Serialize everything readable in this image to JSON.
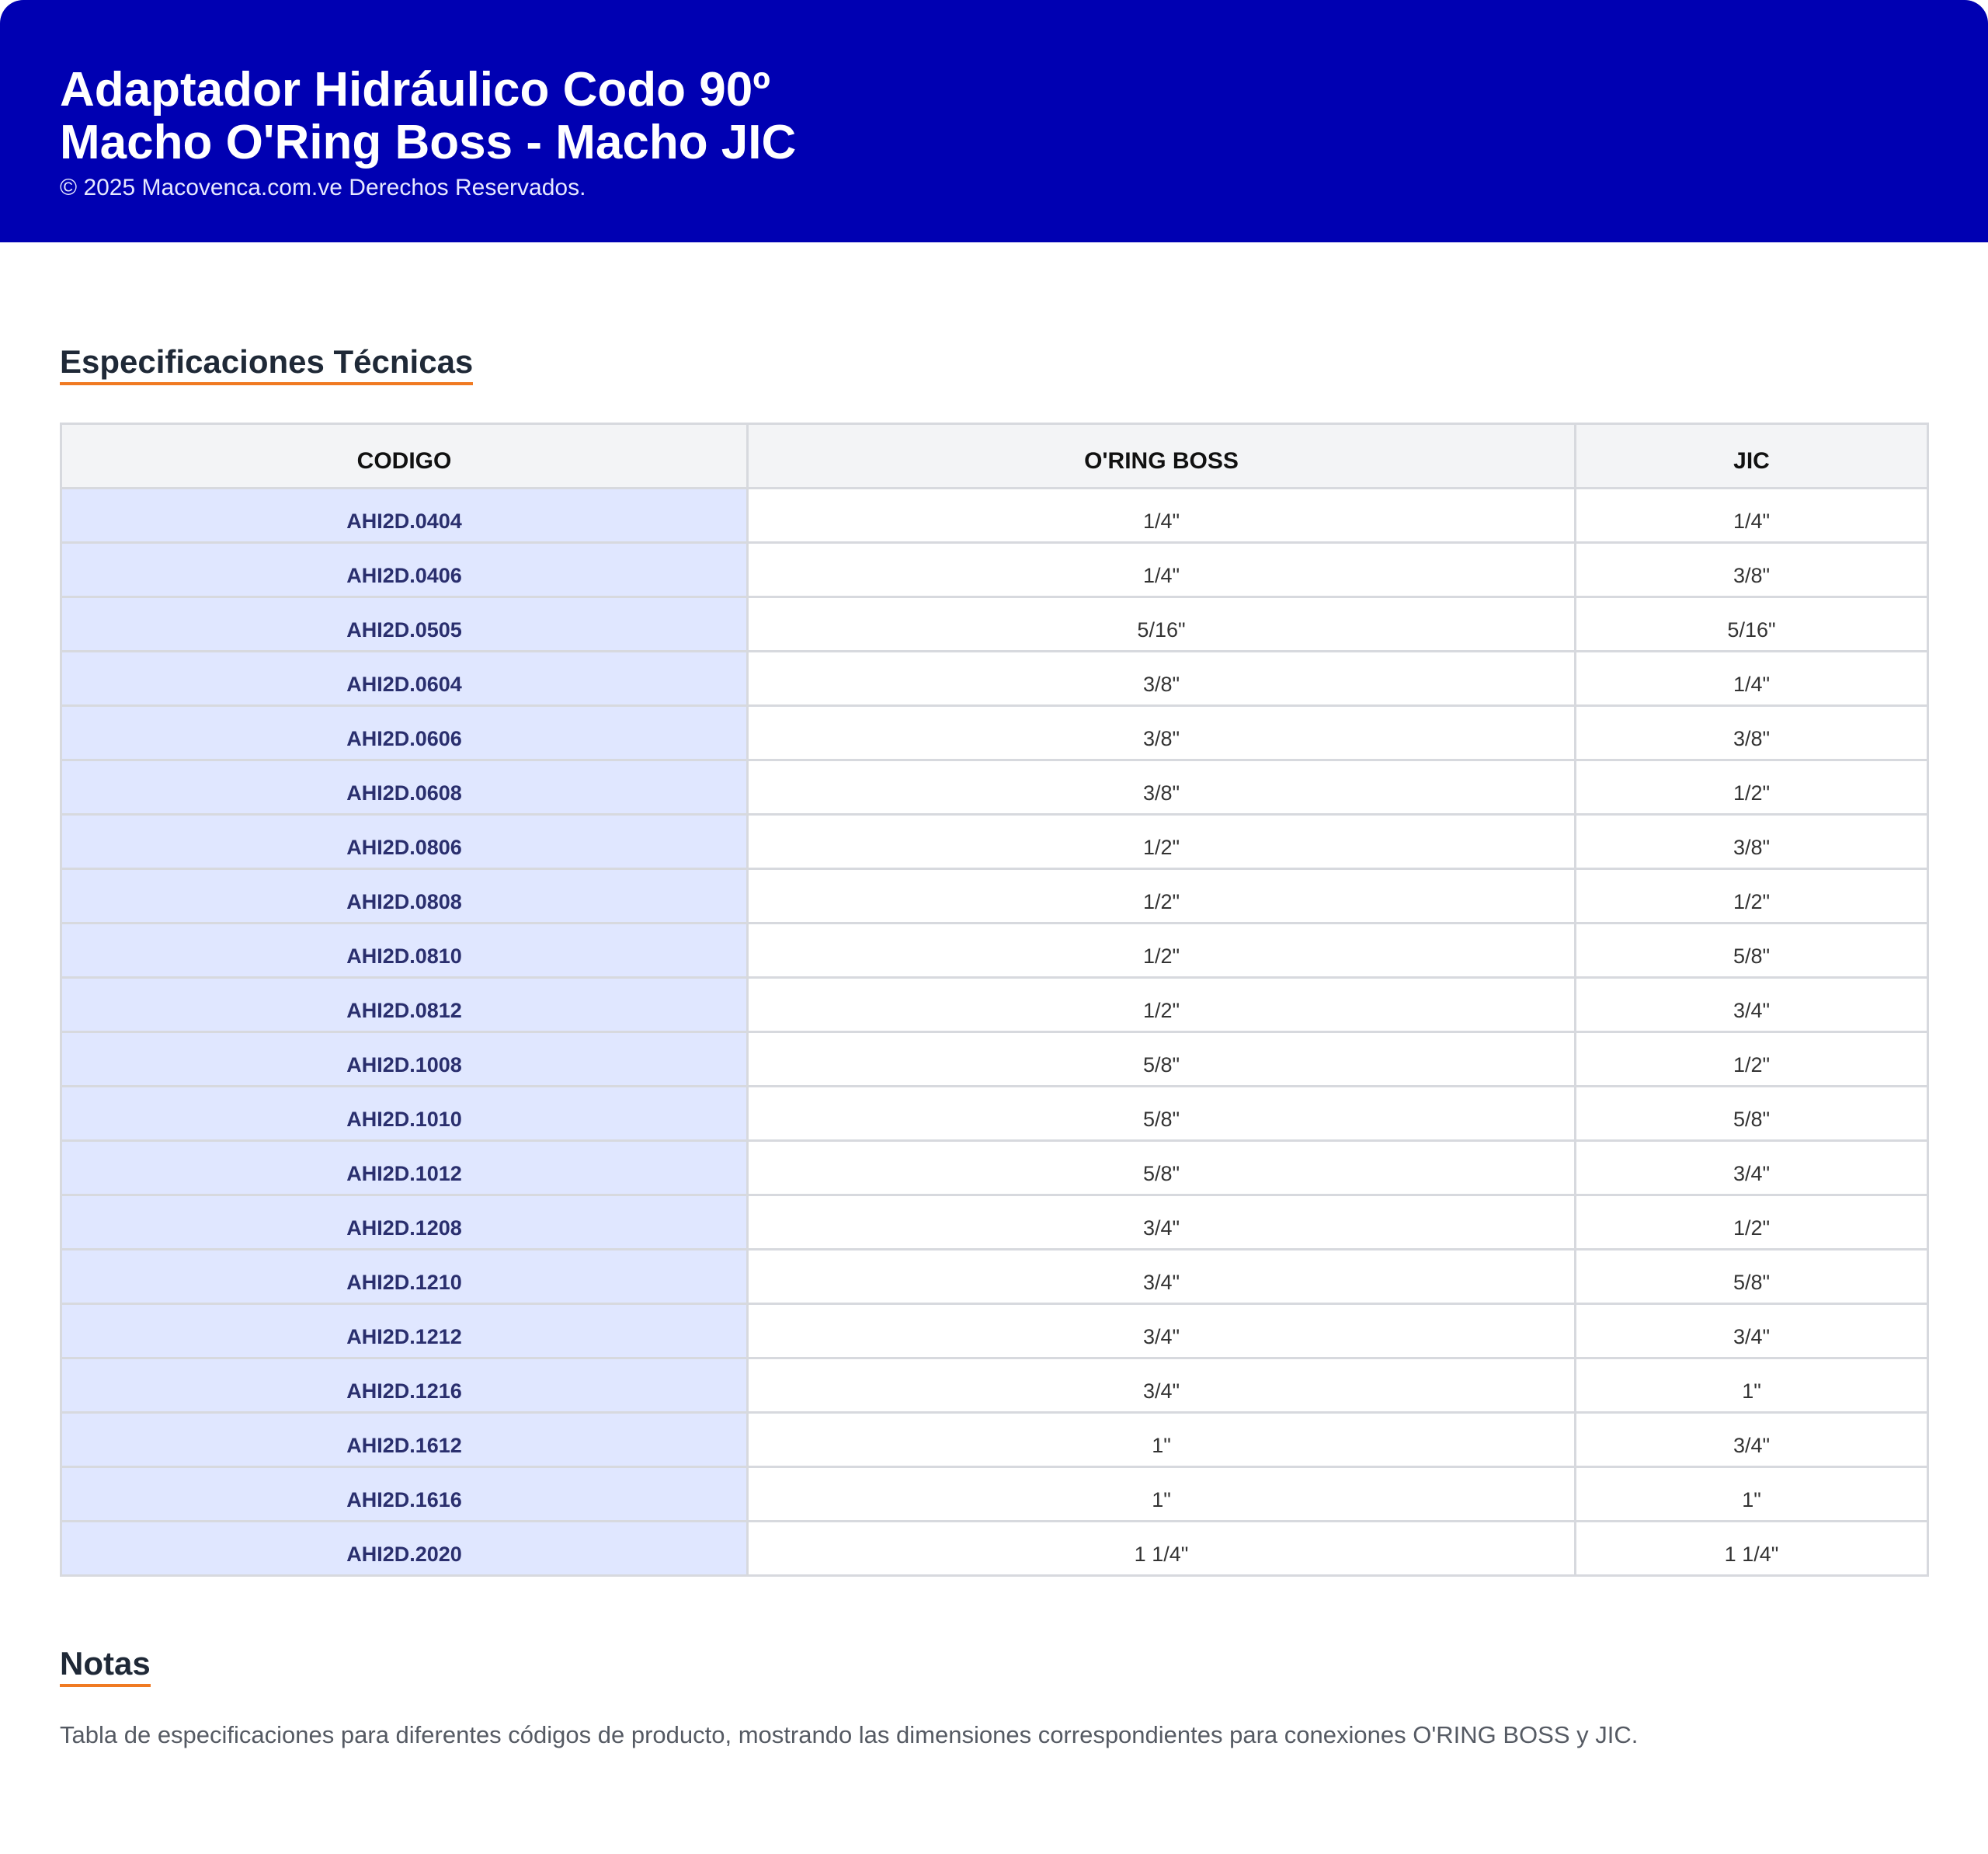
{
  "header": {
    "title_line1": "Adaptador Hidráulico Codo 90º",
    "title_line2": "Macho O'Ring Boss - Macho JIC",
    "copyright": "© 2025 Macovenca.com.ve Derechos Reservados."
  },
  "specs": {
    "title": "Especificaciones Técnicas",
    "columns": [
      "CODIGO",
      "O'RING BOSS",
      "JIC"
    ],
    "rows": [
      {
        "code": "AHI2D.0404",
        "oring_boss": "1/4\"",
        "jic": "1/4\""
      },
      {
        "code": "AHI2D.0406",
        "oring_boss": "1/4\"",
        "jic": "3/8\""
      },
      {
        "code": "AHI2D.0505",
        "oring_boss": "5/16\"",
        "jic": "5/16\""
      },
      {
        "code": "AHI2D.0604",
        "oring_boss": "3/8\"",
        "jic": "1/4\""
      },
      {
        "code": "AHI2D.0606",
        "oring_boss": "3/8\"",
        "jic": "3/8\""
      },
      {
        "code": "AHI2D.0608",
        "oring_boss": "3/8\"",
        "jic": "1/2\""
      },
      {
        "code": "AHI2D.0806",
        "oring_boss": "1/2\"",
        "jic": "3/8\""
      },
      {
        "code": "AHI2D.0808",
        "oring_boss": "1/2\"",
        "jic": "1/2\""
      },
      {
        "code": "AHI2D.0810",
        "oring_boss": "1/2\"",
        "jic": "5/8\""
      },
      {
        "code": "AHI2D.0812",
        "oring_boss": "1/2\"",
        "jic": "3/4\""
      },
      {
        "code": "AHI2D.1008",
        "oring_boss": "5/8\"",
        "jic": "1/2\""
      },
      {
        "code": "AHI2D.1010",
        "oring_boss": "5/8\"",
        "jic": "5/8\""
      },
      {
        "code": "AHI2D.1012",
        "oring_boss": "5/8\"",
        "jic": "3/4\""
      },
      {
        "code": "AHI2D.1208",
        "oring_boss": "3/4\"",
        "jic": "1/2\""
      },
      {
        "code": "AHI2D.1210",
        "oring_boss": "3/4\"",
        "jic": "5/8\""
      },
      {
        "code": "AHI2D.1212",
        "oring_boss": "3/4\"",
        "jic": "3/4\""
      },
      {
        "code": "AHI2D.1216",
        "oring_boss": "3/4\"",
        "jic": "1\""
      },
      {
        "code": "AHI2D.1612",
        "oring_boss": "1\"",
        "jic": "3/4\""
      },
      {
        "code": "AHI2D.1616",
        "oring_boss": "1\"",
        "jic": "1\""
      },
      {
        "code": "AHI2D.2020",
        "oring_boss": "1 1/4\"",
        "jic": "1 1/4\""
      }
    ]
  },
  "notes": {
    "title": "Notas",
    "text": "Tabla de especificaciones para diferentes códigos de producto, mostrando las dimensiones correspondientes para conexiones O'RING BOSS y JIC."
  },
  "colors": {
    "header_bg": "#0000b2",
    "accent_underline": "#f07a22",
    "code_cell_bg": "#e0e7ff"
  }
}
